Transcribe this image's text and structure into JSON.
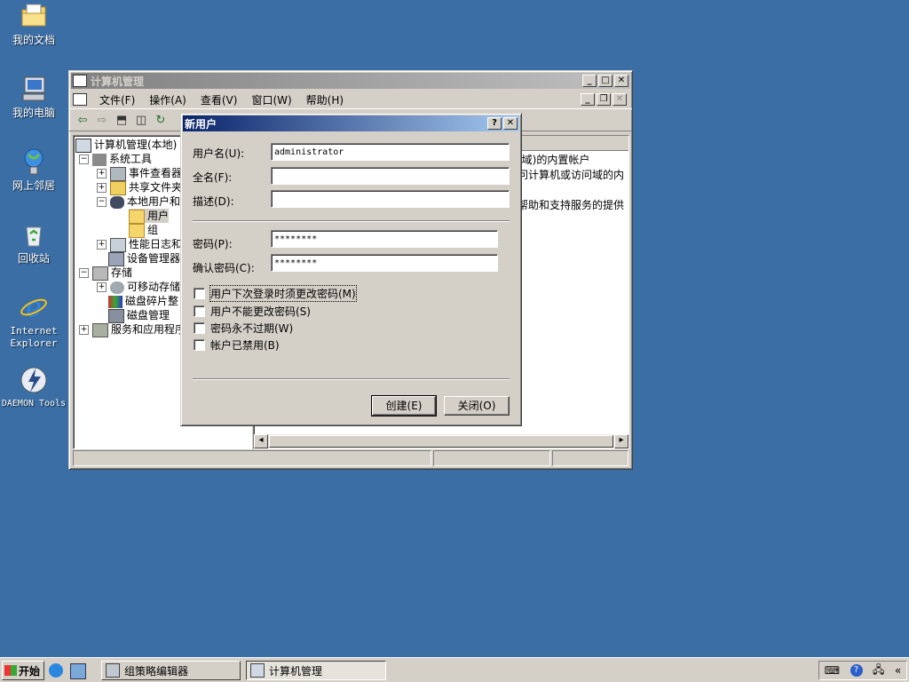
{
  "desktop": {
    "icons": [
      {
        "label": "我的文档",
        "icon": "folder-documents-icon"
      },
      {
        "label": "我的电脑",
        "icon": "computer-icon"
      },
      {
        "label": "网上邻居",
        "icon": "network-icon"
      },
      {
        "label": "回收站",
        "icon": "recycle-bin-icon"
      },
      {
        "label": "Internet Explorer",
        "icon": "ie-icon"
      },
      {
        "label": "DAEMON Tools",
        "icon": "daemon-tools-icon"
      }
    ]
  },
  "main_window": {
    "title": "计算机管理",
    "menu": [
      "文件(F)",
      "操作(A)",
      "查看(V)",
      "窗口(W)",
      "帮助(H)"
    ],
    "tree": [
      {
        "label": "计算机管理(本地)",
        "expander": ""
      },
      {
        "label": "系统工具",
        "expander": "−"
      },
      {
        "label": "事件查看器",
        "expander": "+"
      },
      {
        "label": "共享文件夹",
        "expander": "+"
      },
      {
        "label": "本地用户和",
        "expander": "−"
      },
      {
        "label": "用户",
        "expander": ""
      },
      {
        "label": "组",
        "expander": ""
      },
      {
        "label": "性能日志和",
        "expander": "+"
      },
      {
        "label": "设备管理器",
        "expander": ""
      },
      {
        "label": "存储",
        "expander": "−"
      },
      {
        "label": "可移动存储",
        "expander": "+"
      },
      {
        "label": "磁盘碎片整",
        "expander": ""
      },
      {
        "label": "磁盘管理",
        "expander": ""
      },
      {
        "label": "服务和应用程序",
        "expander": "+"
      }
    ],
    "right_pane_text": [
      "机(域)的内置帐户",
      "问计算机或访问域的内",
      "帮助和支持服务的提供"
    ]
  },
  "dialog": {
    "title": "新用户",
    "help_btn": "?",
    "close_btn": "✕",
    "username_label": "用户名(U):",
    "username_value": "administrator",
    "fullname_label": "全名(F):",
    "fullname_value": "",
    "description_label": "描述(D):",
    "description_value": "",
    "password_label": "密码(P):",
    "password_value": "********",
    "confirm_label": "确认密码(C):",
    "confirm_value": "********",
    "checkboxes": [
      {
        "label": "用户下次登录时须更改密码(M)",
        "checked": false
      },
      {
        "label": "用户不能更改密码(S)",
        "checked": false
      },
      {
        "label": "密码永不过期(W)",
        "checked": false
      },
      {
        "label": "帐户已禁用(B)",
        "checked": false
      }
    ],
    "create_btn": "创建(E)",
    "close_btn_label": "关闭(O)"
  },
  "taskbar": {
    "start_label": "开始",
    "tasks": [
      {
        "label": "组策略编辑器",
        "icon": "gpedit-icon",
        "active": false
      },
      {
        "label": "计算机管理",
        "icon": "computer-management-icon",
        "active": true
      }
    ]
  }
}
